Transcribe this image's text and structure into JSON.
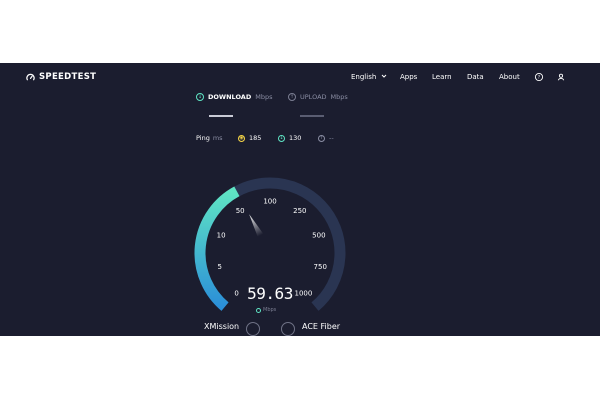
{
  "header": {
    "logo_text": "SPEEDTEST",
    "nav": [
      {
        "label": "English",
        "has_chevron": true
      },
      {
        "label": "Apps"
      },
      {
        "label": "Learn"
      },
      {
        "label": "Data"
      },
      {
        "label": "About"
      }
    ],
    "help_icon": "help-circle-icon",
    "user_icon": "user-icon"
  },
  "tabs": {
    "download": {
      "label": "DOWNLOAD",
      "unit": "Mbps"
    },
    "upload": {
      "label": "UPLOAD",
      "unit": "Mbps"
    }
  },
  "ping": {
    "label": "Ping",
    "unit": "ms",
    "idle": "185",
    "download": "130",
    "upload": "--"
  },
  "gauge": {
    "ticks": [
      "0",
      "5",
      "10",
      "50",
      "100",
      "250",
      "500",
      "750",
      "1000"
    ],
    "speed": "59.63",
    "unit": "Mbps",
    "needle_value": 59.63
  },
  "servers": {
    "isp": "XMission",
    "host": "ACE Fiber"
  },
  "colors": {
    "background": "#1b1d2f",
    "accent_cyan": "#5fe4c4",
    "gauge_track": "#2a3552",
    "download_underline": "#c9cbd6",
    "upload_underline": "#5a5d72",
    "ping_idle": "#f5d547"
  }
}
